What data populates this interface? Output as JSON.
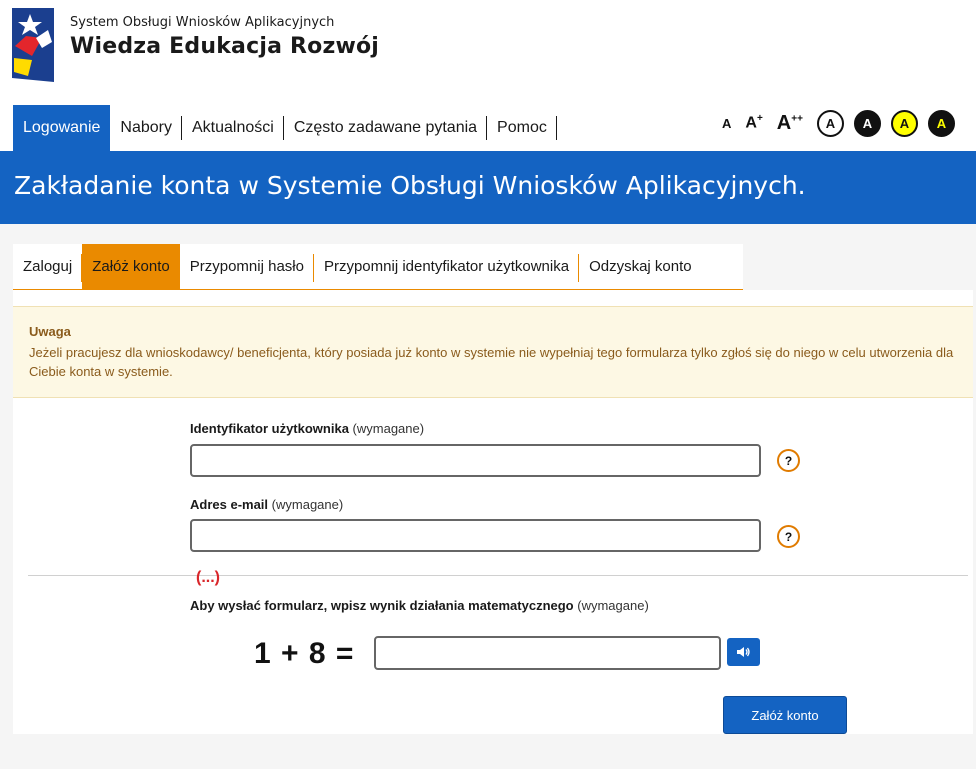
{
  "header": {
    "system_name": "System Obsługi Wniosków Aplikacyjnych",
    "program_name": "Wiedza Edukacja Rozwój",
    "logo_icon": "eu-funds-flag-logo"
  },
  "main_nav": {
    "items": [
      {
        "label": "Logowanie",
        "active": true
      },
      {
        "label": "Nabory"
      },
      {
        "label": "Aktualności"
      },
      {
        "label": "Często zadawane pytania"
      },
      {
        "label": "Pomoc"
      }
    ]
  },
  "accessibility": {
    "font_small": "A",
    "font_medium": "A",
    "font_medium_sup": "+",
    "font_large": "A",
    "font_large_sup": "++",
    "contrast_labels": [
      "A",
      "A",
      "A",
      "A"
    ]
  },
  "banner": {
    "title": "Zakładanie konta w Systemie Obsługi Wniosków Aplikacyjnych."
  },
  "tabs": [
    {
      "label": "Zaloguj"
    },
    {
      "label": "Załóż konto",
      "active": true
    },
    {
      "label": "Przypomnij hasło"
    },
    {
      "label": "Przypomnij identyfikator użytkownika"
    },
    {
      "label": "Odzyskaj konto"
    }
  ],
  "notice": {
    "title": "Uwaga",
    "text": "Jeżeli pracujesz dla wnioskodawcy/ beneficjenta, który posiada już konto w systemie nie wypełniaj tego formularza tylko zgłoś się do niego w celu utworzenia dla Ciebie konta w systemie."
  },
  "form": {
    "user_id": {
      "label": "Identyfikator użytkownika",
      "required": "(wymagane)",
      "value": "",
      "help": "?"
    },
    "email": {
      "label": "Adres e-mail",
      "required": "(wymagane)",
      "value": "",
      "help": "?"
    },
    "ellipsis": "(...)",
    "captcha": {
      "label": "Aby wysłać formularz, wpisz wynik działania matematycznego",
      "required": "(wymagane)",
      "expression": "1 + 8 =",
      "value": ""
    },
    "submit_label": "Załóż konto"
  },
  "colors": {
    "primary_blue": "#1463c2",
    "orange": "#ea8a00",
    "notice_bg": "#fdf8e4",
    "notice_text": "#8a5b1c",
    "ellipsis_red": "#d9262a"
  }
}
